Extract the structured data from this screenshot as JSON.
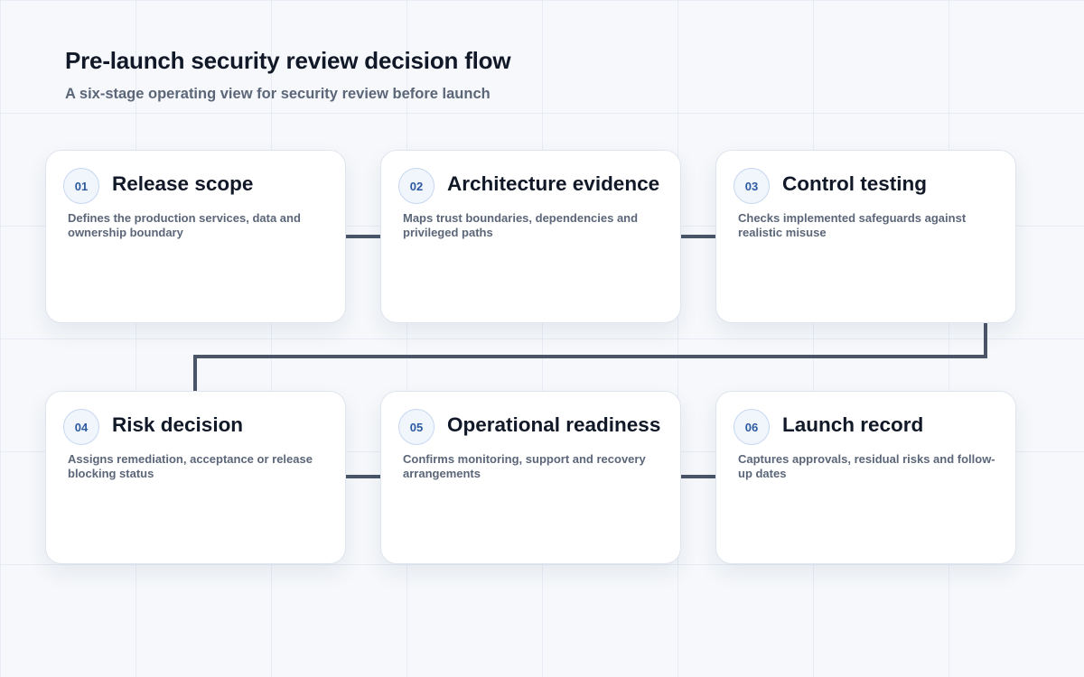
{
  "header": {
    "title": "Pre-launch security review decision flow",
    "subtitle": "A six-stage operating view for security review before launch"
  },
  "stages": [
    {
      "number": "01",
      "title": "Release scope",
      "description": "Defines the production services, data and ownership boundary"
    },
    {
      "number": "02",
      "title": "Architecture evidence",
      "description": "Maps trust boundaries, dependencies and privileged paths"
    },
    {
      "number": "03",
      "title": "Control testing",
      "description": "Checks implemented safeguards against realistic misuse"
    },
    {
      "number": "04",
      "title": "Risk decision",
      "description": "Assigns remediation, acceptance or release blocking status"
    },
    {
      "number": "05",
      "title": "Operational readiness",
      "description": "Confirms monitoring, support and recovery arrangements"
    },
    {
      "number": "06",
      "title": "Launch record",
      "description": "Captures approvals, residual risks and follow-up dates"
    }
  ],
  "colors": {
    "connector": "#4a5568",
    "badge_text": "#2c5aa0",
    "title_text": "#111827",
    "muted_text": "#5b6678"
  }
}
